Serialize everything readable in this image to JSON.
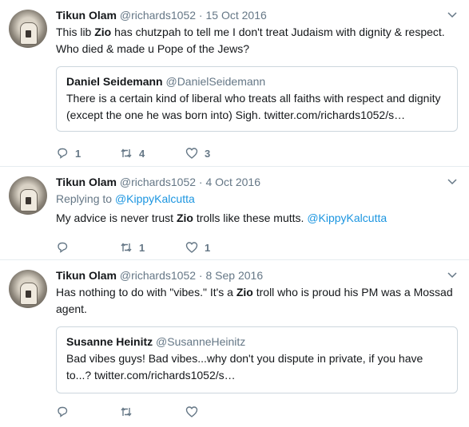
{
  "colors": {
    "link": "#1b95e0",
    "muted": "#657786",
    "border": "#e6ecf0"
  },
  "tweets": [
    {
      "name": "Tikun Olam",
      "handle": "@richards1052",
      "dot": "·",
      "date": "15 Oct 2016",
      "text_parts": [
        "This lib ",
        "Zio",
        " has chutzpah to tell me I don't treat Judaism with dignity & respect. Who died & made u Pope of the Jews?"
      ],
      "quote": {
        "name": "Daniel Seidemann",
        "handle": "@DanielSeidemann",
        "text": "There is a certain kind of liberal who treats all faiths with respect and dignity (except the one he was born into) Sigh. twitter.com/richards1052/s…"
      },
      "reply_count": "1",
      "retweet_count": "4",
      "like_count": "3"
    },
    {
      "name": "Tikun Olam",
      "handle": "@richards1052",
      "dot": "·",
      "date": "4 Oct 2016",
      "replying_prefix": "Replying to ",
      "replying_to": "@KippyKalcutta",
      "text_parts": [
        "My advice is never trust ",
        "Zio",
        " trolls like these mutts. ",
        "@KippyKalcutta"
      ],
      "reply_count": "",
      "retweet_count": "1",
      "like_count": "1"
    },
    {
      "name": "Tikun Olam",
      "handle": "@richards1052",
      "dot": "·",
      "date": "8 Sep 2016",
      "text_parts": [
        "Has nothing to do with \"vibes.\"  It's a ",
        "Zio",
        " troll who is proud his PM was a Mossad agent."
      ],
      "quote": {
        "name": "Susanne Heinitz",
        "handle": "@SusanneHeinitz",
        "text": "Bad vibes guys! Bad vibes...why don't you dispute in private, if you have to...? twitter.com/richards1052/s…"
      },
      "reply_count": "",
      "retweet_count": "",
      "like_count": ""
    }
  ]
}
